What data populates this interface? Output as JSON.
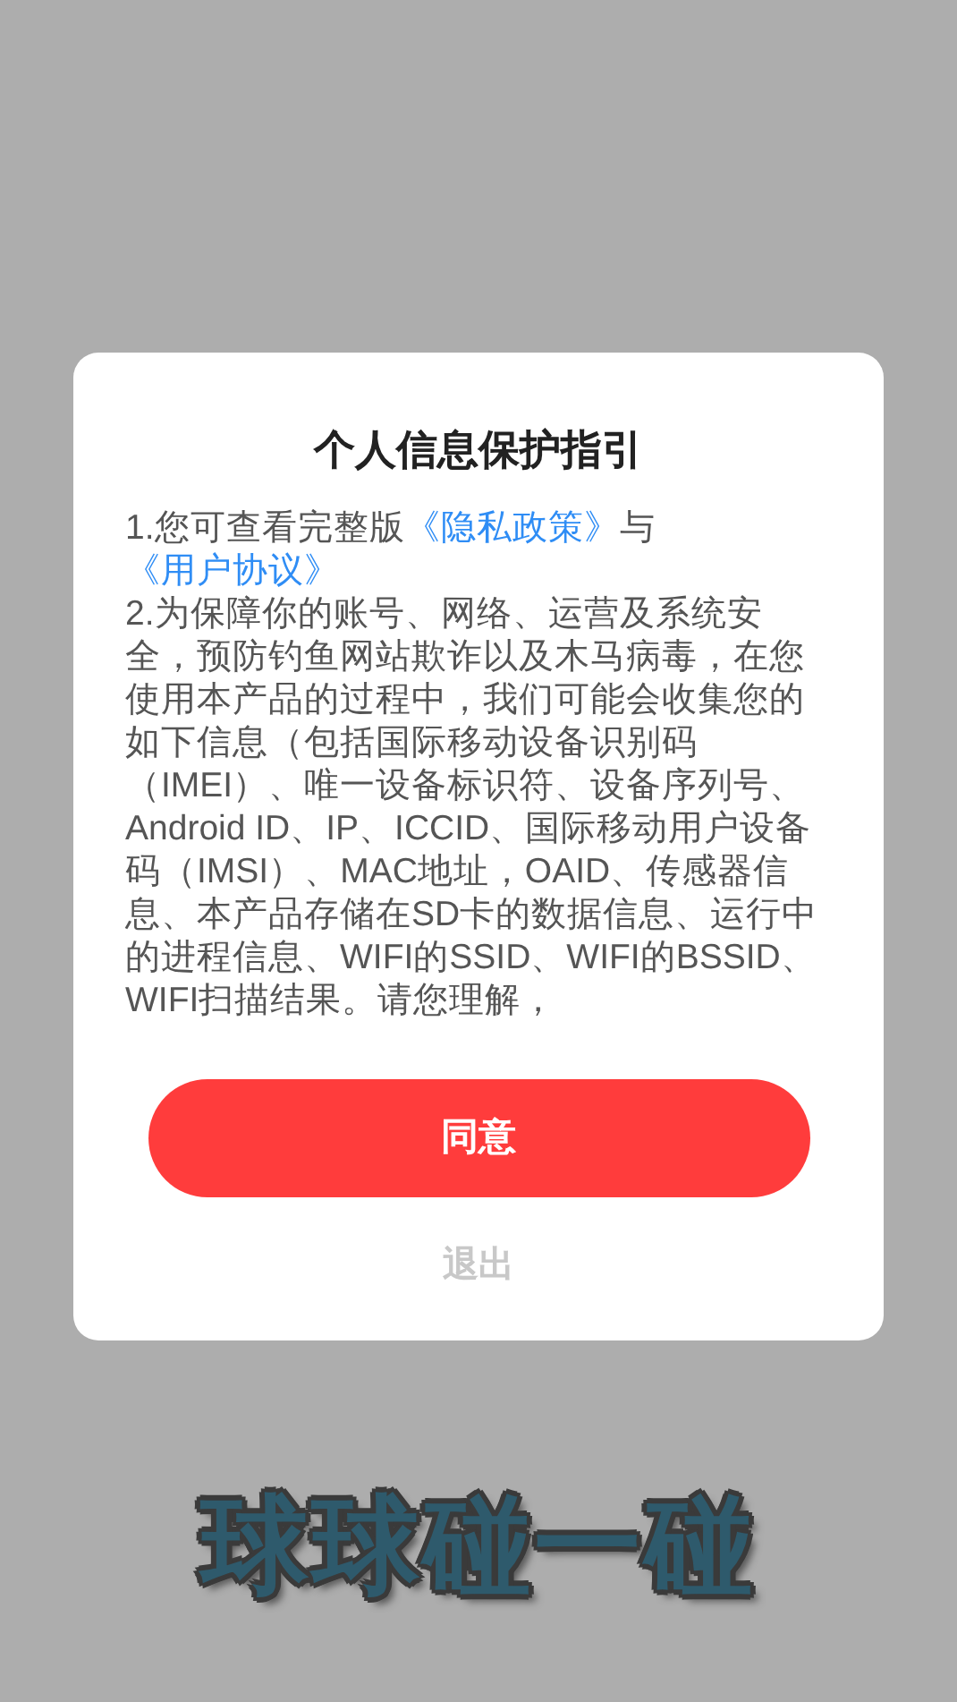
{
  "dialog": {
    "title": "个人信息保护指引",
    "paragraphs": [
      {
        "segments": [
          {
            "kind": "text",
            "text": "1.您可查看完整版"
          },
          {
            "kind": "link",
            "text": "《隐私政策》"
          },
          {
            "kind": "text",
            "text": "与"
          },
          {
            "kind": "link",
            "text": "《用户协议》"
          }
        ]
      },
      {
        "segments": [
          {
            "kind": "text",
            "text": "2.为保障你的账号、网络、运营及系统安全，预防钓鱼网站欺诈以及木马病毒，在您使用本产品的过程中，我们可能会收集您的如下信息（包括国际移动设备识别码（IMEI）、唯一设备标识符、设备序列号、Android ID、IP、ICCID、国际移动用户设备码（IMSI）、MAC地址，OAID、传感器信息、本产品存储在SD卡的数据信息、运行中的进程信息、WIFI的SSID、WIFI的BSSID、WIFI扫描结果。请您理解，"
          }
        ]
      }
    ],
    "agree_button": "同意",
    "exit_button": "退出"
  },
  "app_logo": "球球碰一碰"
}
